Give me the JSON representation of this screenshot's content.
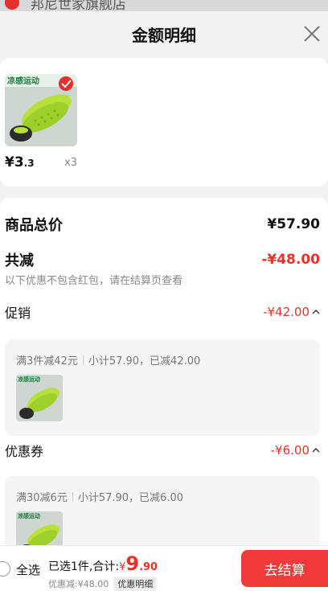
{
  "shop_peek": {
    "name": "邦尼世家旗舰店"
  },
  "header": {
    "title": "金额明细"
  },
  "product": {
    "price_int": "¥3",
    "price_dec": ".3",
    "qty": "x3",
    "image_caption": "凉感运动"
  },
  "summary": {
    "total_label": "商品总价",
    "total_value": "¥57.90",
    "reduce_label": "共减",
    "reduce_value": "-¥48.00",
    "note": "以下优惠不包含红包，请在结算页查看",
    "promo_label": "促销",
    "promo_value": "-¥42.00",
    "promo_rule": "满3件减42元",
    "promo_detail": "小计57.90，已减42.00",
    "coupon_label": "优惠券",
    "coupon_value": "-¥6.00",
    "coupon_rule": "满30减6元",
    "coupon_detail": "小计57.90，已减6.00"
  },
  "bottom": {
    "select_all": "全选",
    "selected_text": "已选1件,合计:",
    "total_currency": "¥",
    "total_int": "9",
    "total_dec": ".90",
    "discount_text": "优惠减:¥48.00",
    "detail_button": "优惠明细",
    "checkout_button": "去结算"
  },
  "colors": {
    "accent": "#e8322b",
    "checkout_bg": "#f23a3a",
    "product_green": "#b8e03a"
  }
}
